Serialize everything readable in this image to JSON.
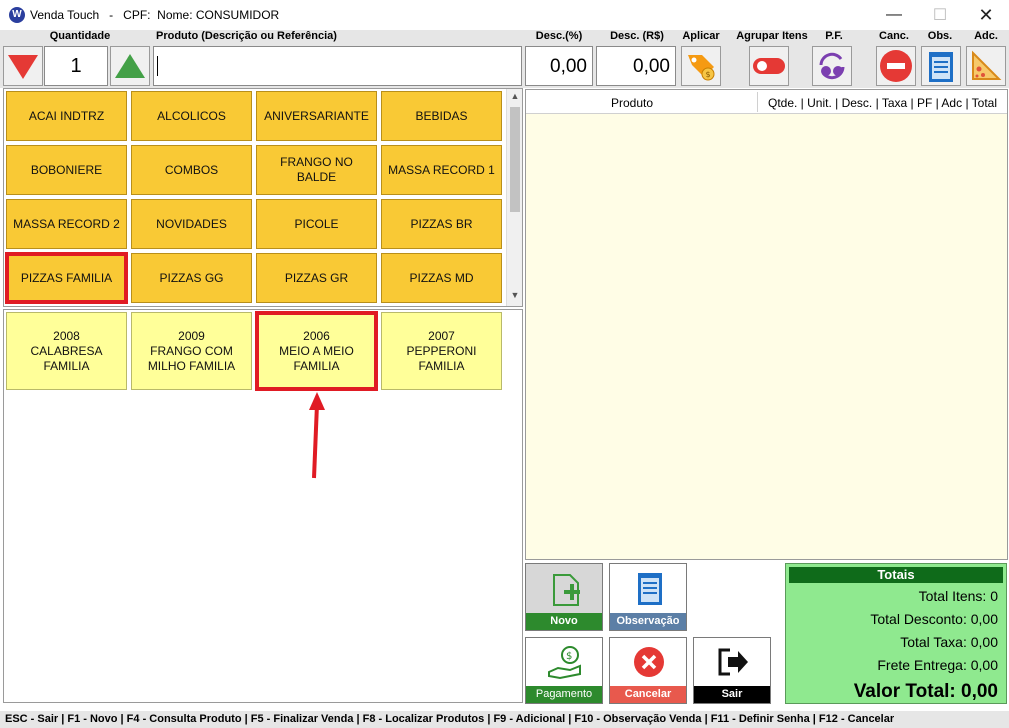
{
  "window": {
    "title": "Venda Touch   -   CPF:  Nome: CONSUMIDOR"
  },
  "header": {
    "quantidade": "Quantidade",
    "produto": "Produto (Descrição ou Referência)",
    "desc_pct": "Desc.(%)",
    "desc_rs": "Desc. (R$)",
    "aplicar": "Aplicar",
    "agrupar": "Agrupar Itens",
    "pf": "P.F.",
    "canc": "Canc.",
    "obs": "Obs.",
    "adc": "Adc."
  },
  "inputs": {
    "quantidade": "1",
    "produto": "",
    "desc_pct": "0,00",
    "desc_rs": "0,00"
  },
  "categories": [
    "ACAI INDTRZ",
    "ALCOLICOS",
    "ANIVERSARIANTE",
    "BEBIDAS",
    "BOBONIERE",
    "COMBOS",
    "FRANGO NO BALDE",
    "MASSA RECORD 1",
    "MASSA RECORD 2",
    "NOVIDADES",
    "PICOLE",
    "PIZZAS BR",
    "PIZZAS FAMILIA",
    "PIZZAS GG",
    "PIZZAS GR",
    "PIZZAS MD"
  ],
  "products": [
    "2008\nCALABRESA\nFAMILIA",
    "2009\nFRANGO COM\nMILHO FAMILIA",
    "2006\nMEIO A MEIO\nFAMILIA",
    "2007\nPEPPERONI\nFAMILIA"
  ],
  "items_table": {
    "col_produto": "Produto",
    "col_rest": "Qtde. | Unit. | Desc. | Taxa | PF | Adc | Total"
  },
  "actions": {
    "novo": "Novo",
    "observacao": "Observação",
    "pagamento": "Pagamento",
    "cancelar": "Cancelar",
    "sair": "Sair"
  },
  "totals": {
    "title": "Totais",
    "total_itens": "Total Itens: 0",
    "total_desconto": "Total Desconto: 0,00",
    "total_taxa": "Total Taxa: 0,00",
    "frete": "Frete Entrega: 0,00",
    "valor_total": "Valor Total: 0,00"
  },
  "shortcuts": "ESC - Sair | F1 - Novo | F4 - Consulta Produto | F5 - Finalizar Venda | F8 - Localizar Produtos | F9 - Adicional | F10 - Observação Venda | F11 - Definir Senha | F12 - Cancelar",
  "colors": {
    "category": "#f9c935",
    "product": "#ffff99",
    "highlight": "#e01b24",
    "totals_bg": "#8fe98f",
    "totals_header": "#0f6b1a"
  }
}
